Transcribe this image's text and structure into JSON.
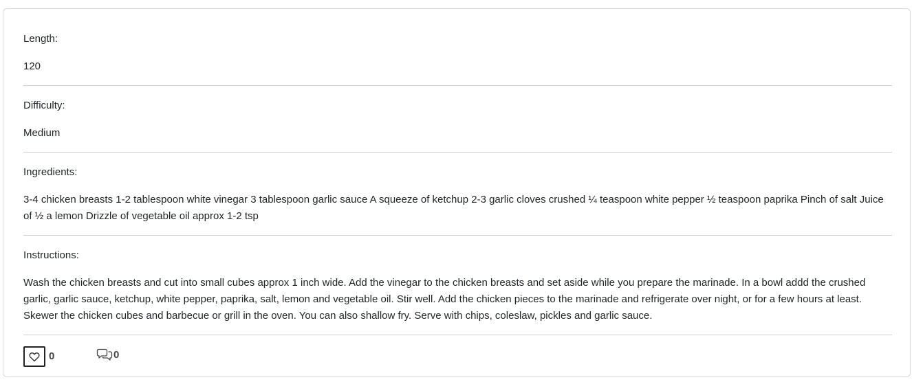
{
  "length": {
    "label": "Length:",
    "value": "120"
  },
  "difficulty": {
    "label": "Difficulty:",
    "value": "Medium"
  },
  "ingredients": {
    "label": "Ingredients:",
    "value": "3-4 chicken breasts 1-2 tablespoon white vinegar 3 tablespoon garlic sauce A squeeze of ketchup 2-3 garlic cloves crushed ¼ teaspoon white pepper ½ teaspoon paprika Pinch of salt Juice of ½ a lemon Drizzle of vegetable oil approx 1-2 tsp"
  },
  "instructions": {
    "label": "Instructions:",
    "value": "Wash the chicken breasts and cut into small cubes approx 1 inch wide. Add the vinegar to the chicken breasts and set aside while you prepare the marinade. In a bowl addd the crushed garlic, garlic sauce, ketchup, white pepper, paprika, salt, lemon and vegetable oil. Stir well. Add the chicken pieces to the marinade and refrigerate over night, or for a few hours at least. Skewer the chicken cubes and barbecue or grill in the oven. You can also shallow fry. Serve with chips, coleslaw, pickles and garlic sauce."
  },
  "footer": {
    "like_icon": "heart-icon",
    "like_count": "0",
    "comment_icon": "comments-icon",
    "comment_count": "0"
  }
}
